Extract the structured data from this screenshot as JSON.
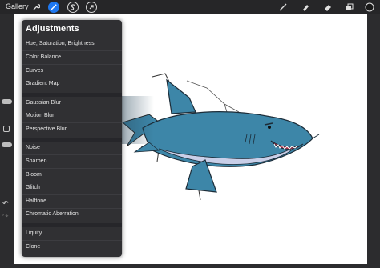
{
  "topbar": {
    "gallery_label": "Gallery",
    "tools": [
      "wrench-icon",
      "adjustments-wand-icon",
      "selection-s-icon",
      "transform-arrow-icon",
      "brush-icon",
      "smudge-icon",
      "eraser-icon",
      "layers-icon",
      "color-swatch-icon"
    ]
  },
  "adjustments": {
    "title": "Adjustments",
    "group1": [
      "Hue, Saturation, Brightness",
      "Color Balance",
      "Curves",
      "Gradient Map"
    ],
    "group2": [
      "Gaussian Blur",
      "Motion Blur",
      "Perspective Blur"
    ],
    "group3": [
      "Noise",
      "Sharpen",
      "Bloom",
      "Glitch",
      "Halftone",
      "Chromatic Aberration"
    ],
    "group4": [
      "Liquify",
      "Clone"
    ]
  },
  "colors": {
    "accent": "#1e78f0",
    "shark_body": "#3d86a8",
    "shark_belly": "#c9cfe8",
    "panel_bg": "#303033"
  }
}
